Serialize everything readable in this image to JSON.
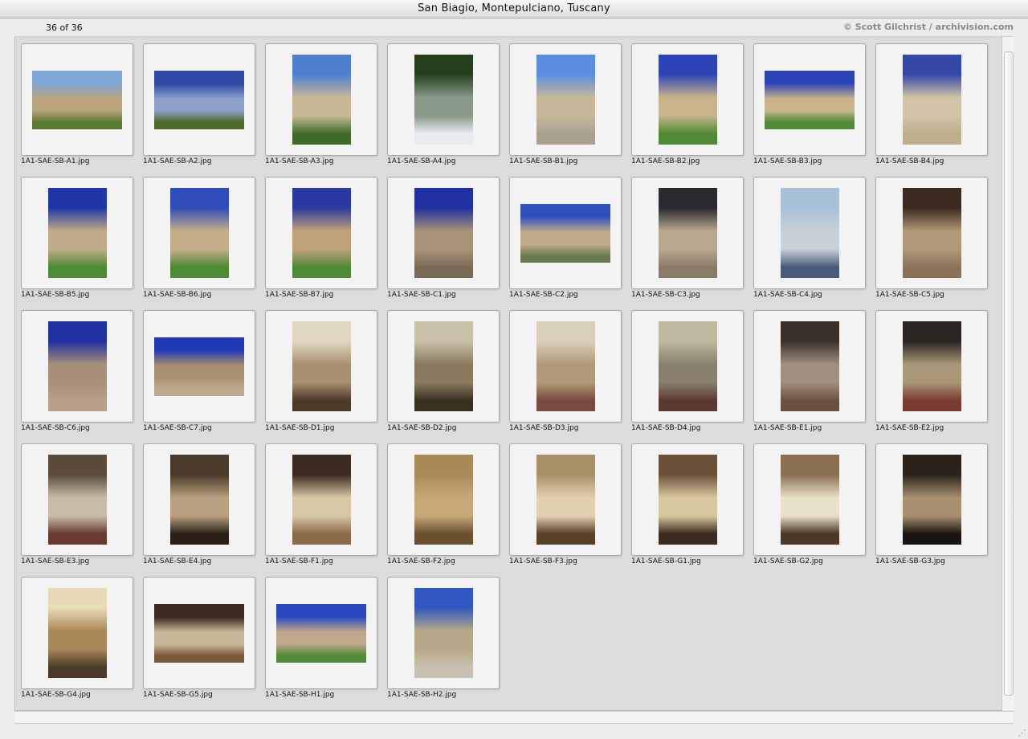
{
  "window": {
    "title": "San Biagio, Montepulciano, Tuscany"
  },
  "header": {
    "count": "36 of 36",
    "credit": "© Scott Gilchrist / archivision.com"
  },
  "thumbnails": [
    {
      "file": "1A1-SAE-SB-A1.jpg",
      "orient": "landscape",
      "colors": [
        "#7fa7d8",
        "#b9a37a",
        "#5a7a30"
      ]
    },
    {
      "file": "1A1-SAE-SB-A2.jpg",
      "orient": "landscape",
      "colors": [
        "#2f49a8",
        "#8aa0c8",
        "#4f6a2a"
      ]
    },
    {
      "file": "1A1-SAE-SB-A3.jpg",
      "orient": "portrait",
      "colors": [
        "#4f80d0",
        "#c8b896",
        "#3f6a2a"
      ]
    },
    {
      "file": "1A1-SAE-SB-A4.jpg",
      "orient": "portrait",
      "colors": [
        "#26401f",
        "#8a9a8a",
        "#e8ecf0"
      ]
    },
    {
      "file": "1A1-SAE-SB-B1.jpg",
      "orient": "portrait",
      "colors": [
        "#5a8ee0",
        "#c8b89a",
        "#a8a090"
      ]
    },
    {
      "file": "1A1-SAE-SB-B2.jpg",
      "orient": "portrait",
      "colors": [
        "#2d44b8",
        "#c9b48c",
        "#4f8a34"
      ]
    },
    {
      "file": "1A1-SAE-SB-B3.jpg",
      "orient": "landscape",
      "colors": [
        "#2d44b8",
        "#c9b48c",
        "#4f8a34"
      ]
    },
    {
      "file": "1A1-SAE-SB-B4.jpg",
      "orient": "portrait",
      "colors": [
        "#3448a8",
        "#d2c4a8",
        "#bfae8e"
      ]
    },
    {
      "file": "1A1-SAE-SB-B5.jpg",
      "orient": "portrait",
      "colors": [
        "#1f36a8",
        "#c0ac88",
        "#4f8a34"
      ]
    },
    {
      "file": "1A1-SAE-SB-B6.jpg",
      "orient": "portrait",
      "colors": [
        "#2f4cb8",
        "#c4ae8a",
        "#4f8a34"
      ]
    },
    {
      "file": "1A1-SAE-SB-B7.jpg",
      "orient": "portrait",
      "colors": [
        "#2a3aa0",
        "#c0a27a",
        "#4f8a34"
      ]
    },
    {
      "file": "1A1-SAE-SB-C1.jpg",
      "orient": "portrait",
      "colors": [
        "#2030a0",
        "#a89478",
        "#7a6a58"
      ]
    },
    {
      "file": "1A1-SAE-SB-C2.jpg",
      "orient": "landscape",
      "colors": [
        "#3050c0",
        "#c0ac8c",
        "#6a7a50"
      ]
    },
    {
      "file": "1A1-SAE-SB-C3.jpg",
      "orient": "portrait",
      "colors": [
        "#2a2a30",
        "#b8a890",
        "#8a7a68"
      ]
    },
    {
      "file": "1A1-SAE-SB-C4.jpg",
      "orient": "portrait",
      "colors": [
        "#a8c0d8",
        "#c8d0d8",
        "#4a5a7a"
      ]
    },
    {
      "file": "1A1-SAE-SB-C5.jpg",
      "orient": "portrait",
      "colors": [
        "#3a2a20",
        "#b09878",
        "#8a7258"
      ]
    },
    {
      "file": "1A1-SAE-SB-C6.jpg",
      "orient": "portrait",
      "colors": [
        "#1f30a0",
        "#a89078",
        "#b8a088"
      ]
    },
    {
      "file": "1A1-SAE-SB-C7.jpg",
      "orient": "landscape",
      "colors": [
        "#2038b8",
        "#a89070",
        "#c0aa90"
      ]
    },
    {
      "file": "1A1-SAE-SB-D1.jpg",
      "orient": "portrait",
      "colors": [
        "#e0d8c0",
        "#a89070",
        "#4a3a28"
      ]
    },
    {
      "file": "1A1-SAE-SB-D2.jpg",
      "orient": "portrait",
      "colors": [
        "#c8c0a8",
        "#8a7a60",
        "#3a3020"
      ]
    },
    {
      "file": "1A1-SAE-SB-D3.jpg",
      "orient": "portrait",
      "colors": [
        "#d8d0b8",
        "#b09878",
        "#7a4a40"
      ]
    },
    {
      "file": "1A1-SAE-SB-D4.jpg",
      "orient": "portrait",
      "colors": [
        "#c0b8a0",
        "#8a8070",
        "#5a3a30"
      ]
    },
    {
      "file": "1A1-SAE-SB-E1.jpg",
      "orient": "portrait",
      "colors": [
        "#3a3028",
        "#a09080",
        "#6a5040"
      ]
    },
    {
      "file": "1A1-SAE-SB-E2.jpg",
      "orient": "portrait",
      "colors": [
        "#2a2420",
        "#a89878",
        "#7a3a30"
      ]
    },
    {
      "file": "1A1-SAE-SB-E3.jpg",
      "orient": "portrait",
      "colors": [
        "#5a4a3a",
        "#c8bca8",
        "#6a3a30"
      ]
    },
    {
      "file": "1A1-SAE-SB-E4.jpg",
      "orient": "portrait",
      "colors": [
        "#4a3a2a",
        "#b8a080",
        "#2a2018"
      ]
    },
    {
      "file": "1A1-SAE-SB-F1.jpg",
      "orient": "portrait",
      "colors": [
        "#3a2a20",
        "#d8c8a8",
        "#8a6a48"
      ]
    },
    {
      "file": "1A1-SAE-SB-F2.jpg",
      "orient": "portrait",
      "colors": [
        "#a88a58",
        "#c8a878",
        "#6a5030"
      ]
    },
    {
      "file": "1A1-SAE-SB-F3.jpg",
      "orient": "portrait",
      "colors": [
        "#a89068",
        "#e0d0b0",
        "#5a4028"
      ]
    },
    {
      "file": "1A1-SAE-SB-G1.jpg",
      "orient": "portrait",
      "colors": [
        "#6a5038",
        "#d8c8a0",
        "#3a2a20"
      ]
    },
    {
      "file": "1A1-SAE-SB-G2.jpg",
      "orient": "portrait",
      "colors": [
        "#8a7050",
        "#e8e0c8",
        "#4a3828"
      ]
    },
    {
      "file": "1A1-SAE-SB-G3.jpg",
      "orient": "portrait",
      "colors": [
        "#2a2218",
        "#a89070",
        "#1a1410"
      ]
    },
    {
      "file": "1A1-SAE-SB-G4.jpg",
      "orient": "portrait",
      "colors": [
        "#e8dcb8",
        "#a88858",
        "#4a3a2a"
      ]
    },
    {
      "file": "1A1-SAE-SB-G5.jpg",
      "orient": "landscape",
      "colors": [
        "#3a2a20",
        "#c8b898",
        "#7a5a38"
      ]
    },
    {
      "file": "1A1-SAE-SB-H1.jpg",
      "orient": "landscape",
      "colors": [
        "#2848c0",
        "#c0a888",
        "#4f8a34"
      ]
    },
    {
      "file": "1A1-SAE-SB-H2.jpg",
      "orient": "portrait",
      "colors": [
        "#3058c0",
        "#b8a888",
        "#c8c0b0"
      ]
    }
  ]
}
